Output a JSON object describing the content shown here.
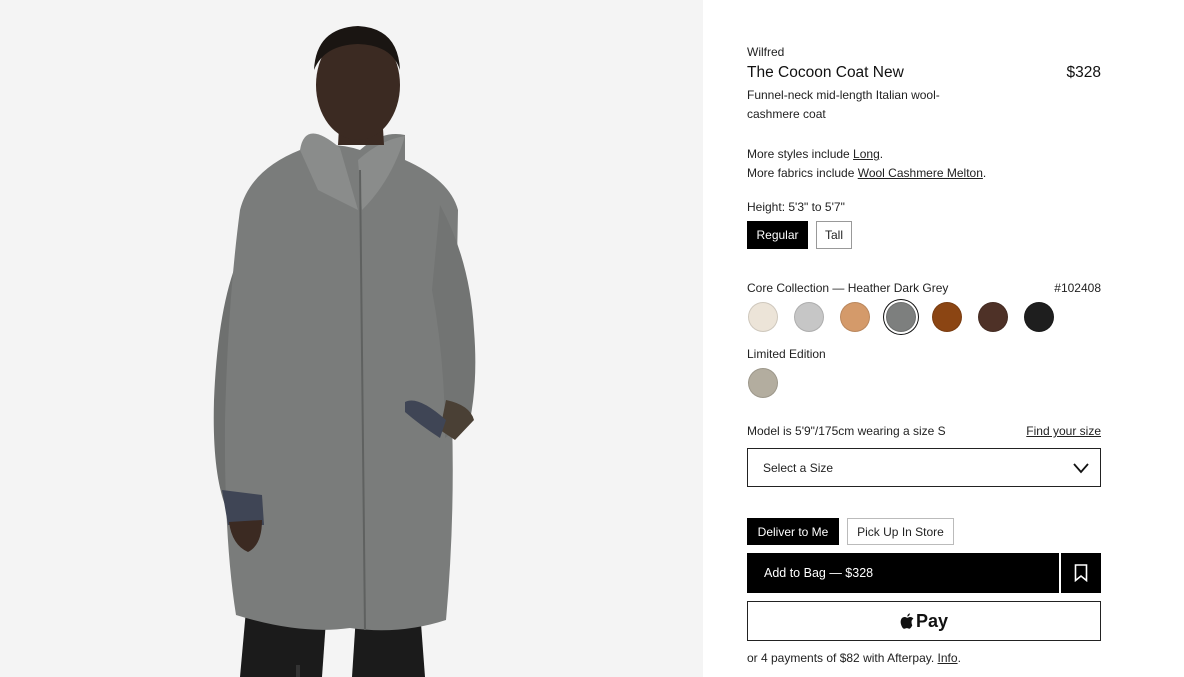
{
  "product": {
    "brand": "Wilfred",
    "title": "The Cocoon Coat New",
    "price": "$328",
    "description": "Funnel-neck mid-length Italian wool-cashmere coat"
  },
  "more_styles": {
    "prefix": "More styles include ",
    "link": "Long",
    "suffix": "."
  },
  "more_fabrics": {
    "prefix": "More fabrics include ",
    "link": "Wool Cashmere Melton",
    "suffix": "."
  },
  "height": {
    "label": "Height: 5'3\" to 5'7\"",
    "options": [
      "Regular",
      "Tall"
    ],
    "selected": "Regular"
  },
  "collection": {
    "label": "Core Collection — Heather Dark Grey",
    "code": "#102408",
    "swatches": [
      {
        "name": "cream",
        "color": "#ece4d8"
      },
      {
        "name": "light-grey",
        "color": "#c6c6c6"
      },
      {
        "name": "camel",
        "color": "#d49a6a"
      },
      {
        "name": "heather-dark-grey",
        "color": "#7d7f7e",
        "selected": true
      },
      {
        "name": "rust",
        "color": "#8b4513"
      },
      {
        "name": "brown",
        "color": "#4e3127"
      },
      {
        "name": "black",
        "color": "#1e1e1e"
      }
    ]
  },
  "limited": {
    "label": "Limited Edition",
    "swatches": [
      {
        "name": "taupe",
        "color": "#b3ad9f"
      }
    ]
  },
  "sizing": {
    "model_note": "Model is 5'9\"/175cm wearing a size S",
    "find_size": "Find your size",
    "select_placeholder": "Select a Size"
  },
  "delivery": {
    "options": [
      "Deliver to Me",
      "Pick Up In Store"
    ],
    "selected": "Deliver to Me"
  },
  "actions": {
    "add_to_bag": "Add to Bag — $328",
    "apple_pay": "Pay"
  },
  "afterpay": {
    "text": "or 4 payments of $82 with Afterpay. ",
    "link": "Info",
    "suffix": "."
  },
  "icons": [
    "bookmark-icon",
    "chevron-down-icon",
    "apple-logo-icon"
  ],
  "colors": {
    "accent": "#000000",
    "background": "#ffffff",
    "photo_bg": "#f4f4f4"
  }
}
